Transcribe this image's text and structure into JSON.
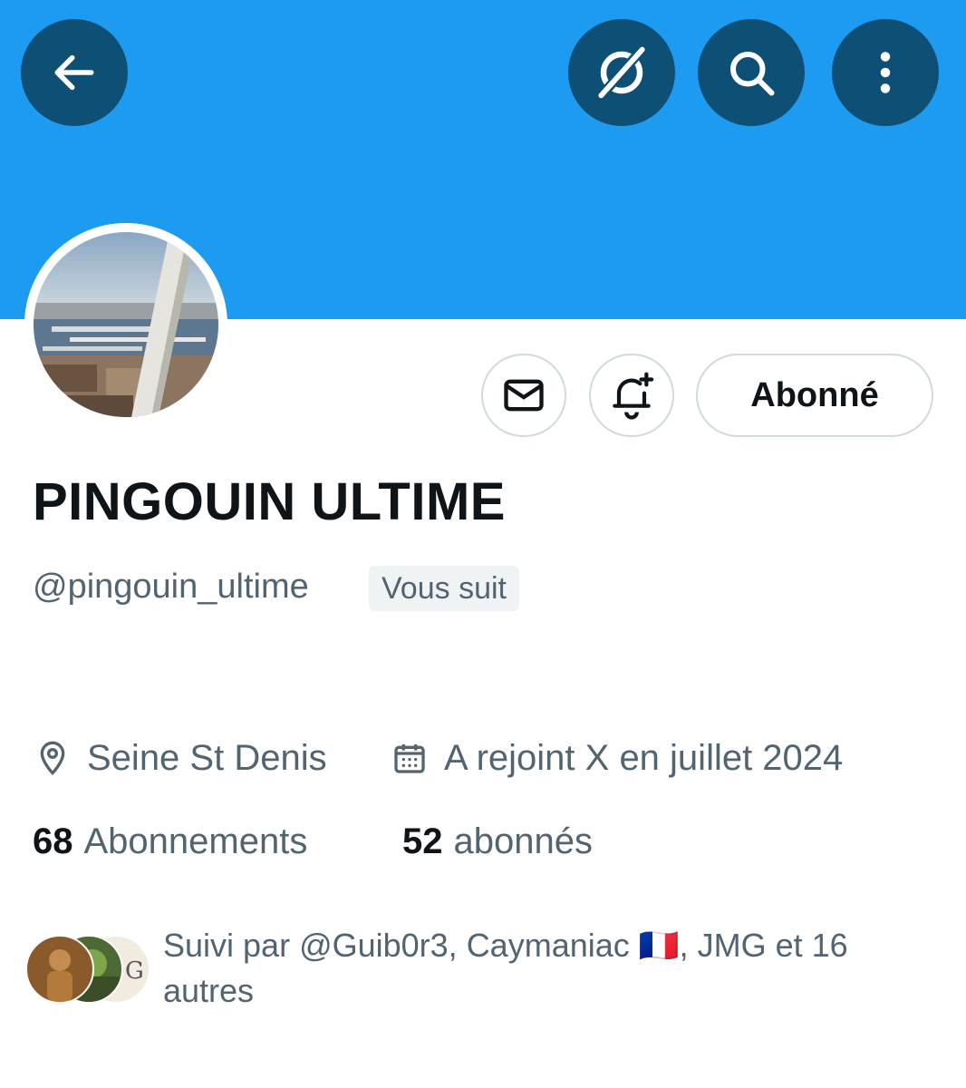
{
  "header": {
    "back_icon": "arrow-left-icon",
    "grok_icon": "grok-icon",
    "search_icon": "search-icon",
    "more_icon": "more-vertical-icon",
    "banner_color": "#1d9bf0",
    "button_bg": "#0e4f76"
  },
  "profile": {
    "display_name": "PINGOUIN ULTIME",
    "handle": "@pingouin_ultime",
    "follows_you_badge": "Vous suit",
    "location": "Seine St Denis",
    "joined": "A rejoint X en juillet 2024",
    "following_count": "68",
    "following_label": "Abonnements",
    "followers_count": "52",
    "followers_label": "abonnés",
    "followed_by_text": "Suivi par @Guib0r3, Caymaniac 🇫🇷, JMG et 16 autres"
  },
  "actions": {
    "message_icon": "envelope-icon",
    "notify_icon": "bell-plus-icon",
    "follow_label": "Abonné"
  },
  "colors": {
    "text_primary": "#0f1419",
    "text_secondary": "#536471",
    "border": "#cfd9de"
  }
}
